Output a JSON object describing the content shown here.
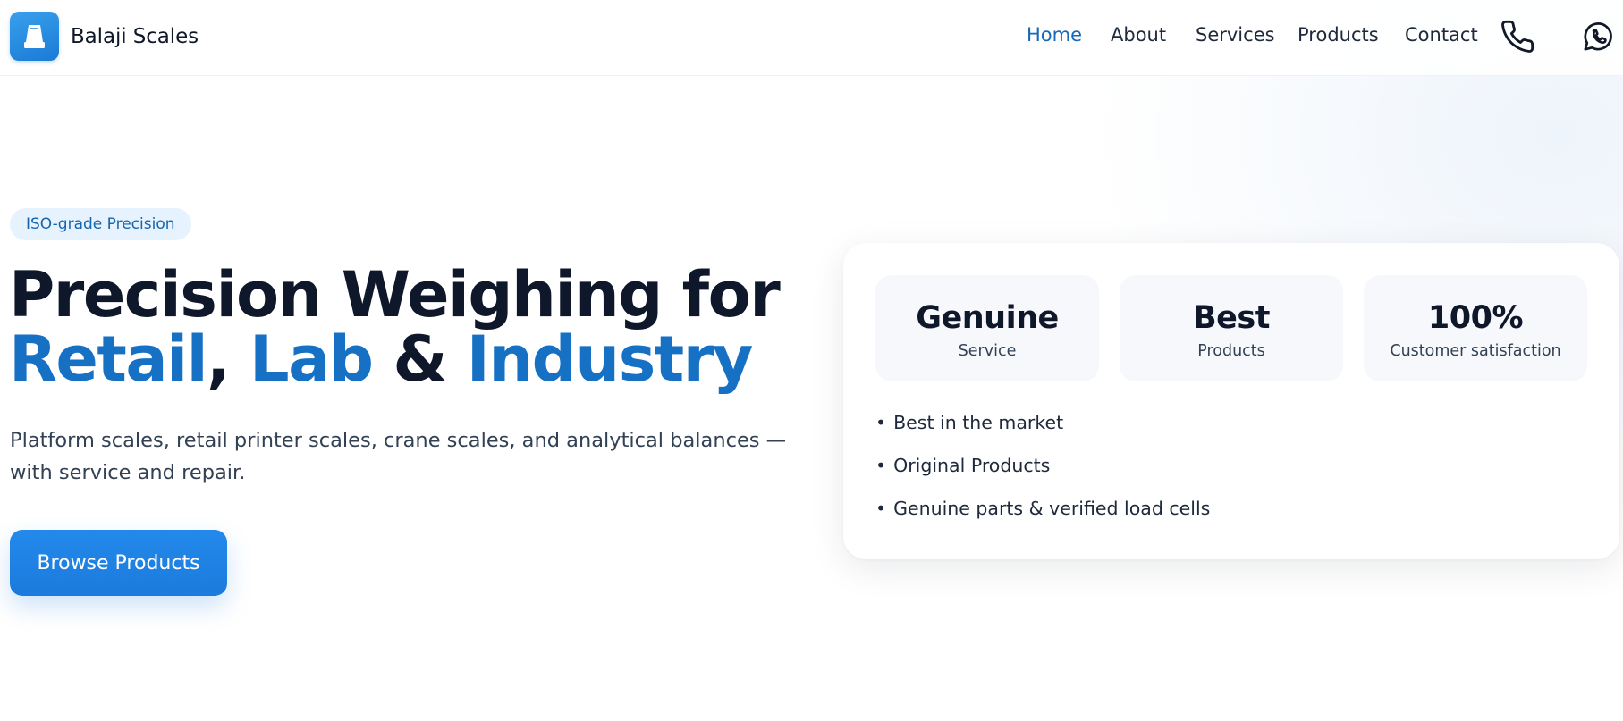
{
  "header": {
    "brand": "Balaji Scales",
    "logo_icon": "scale-weight-icon",
    "nav": [
      {
        "label": "Home",
        "active": true
      },
      {
        "label": "About",
        "active": false
      },
      {
        "label": "Services",
        "active": false
      },
      {
        "label": "Products",
        "active": false
      },
      {
        "label": "Contact",
        "active": false
      }
    ],
    "actions": [
      {
        "icon": "phone-icon"
      },
      {
        "icon": "whatsapp-icon"
      }
    ]
  },
  "hero": {
    "badge": "ISO-grade Precision",
    "title_line1": "Precision Weighing for",
    "title_line2": {
      "retail": "Retail",
      "comma": ",",
      "lab": "Lab",
      "amp": "&",
      "industry": "Industry"
    },
    "lead": "Platform scales, retail printer scales, crane scales, and analytical balances — with service and repair.",
    "cta": "Browse Products"
  },
  "highlights": {
    "stats": [
      {
        "value": "Genuine",
        "label": "Service"
      },
      {
        "value": "Best",
        "label": "Products"
      },
      {
        "value": "100%",
        "label": "Customer satisfaction"
      }
    ],
    "bullets": [
      "Best in the market",
      "Original Products",
      "Genuine parts & verified load cells"
    ]
  },
  "colors": {
    "accent": "#1b7bdd",
    "accent_text": "#1670c4",
    "nav_active": "#1668b8",
    "badge_bg": "#e6f2fd",
    "card_tile_bg": "#f6f8fb"
  }
}
